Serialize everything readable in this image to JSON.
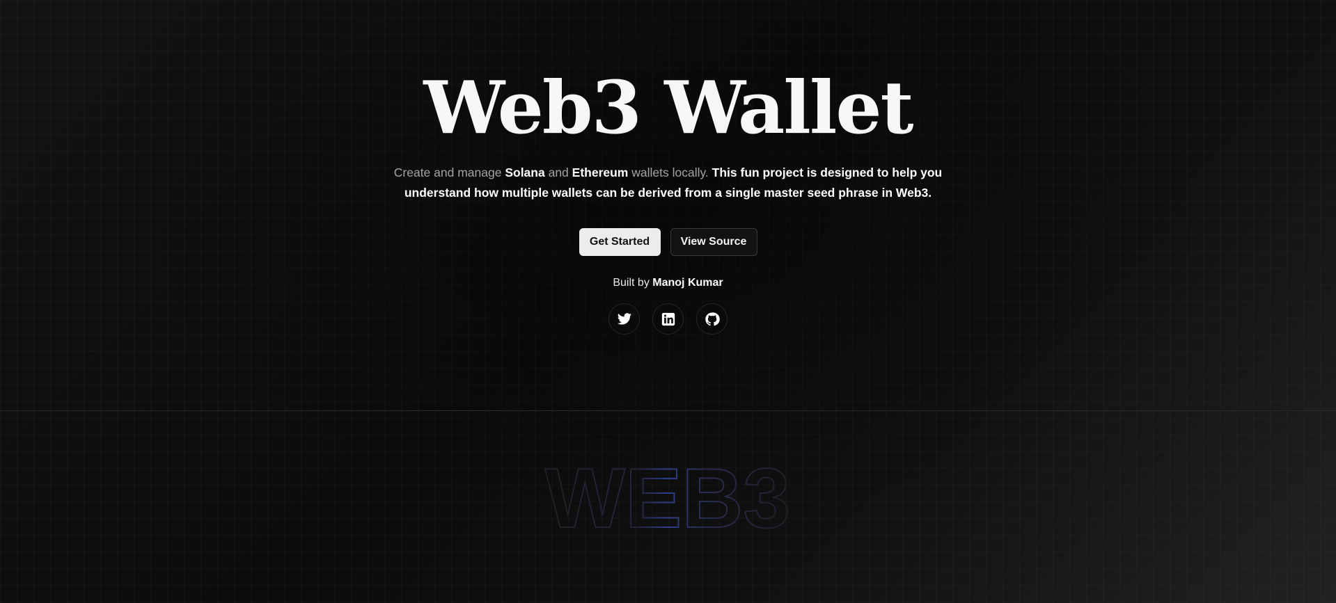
{
  "hero": {
    "title": "Web3 Wallet",
    "description": {
      "part1": "Create and manage ",
      "solana": "Solana",
      "part2": " and ",
      "ethereum": "Ethereum",
      "part3": " wallets locally. ",
      "emphasis": "This fun project is designed to help you understand how multiple wallets can be derived from a single master seed phrase in Web3."
    },
    "buttons": {
      "get_started": "Get Started",
      "view_source": "View Source"
    },
    "built_by": {
      "prefix": "Built by ",
      "author": "Manoj Kumar"
    },
    "social": [
      {
        "name": "twitter-icon"
      },
      {
        "name": "linkedin-icon"
      },
      {
        "name": "github-icon"
      }
    ]
  },
  "watermark": {
    "text": "WEB3"
  },
  "colors": {
    "background": "#0c0c0d",
    "primary_button": "#ececec",
    "watermark_stroke": "#26263a",
    "watermark_accent": "#2d3f8f"
  }
}
